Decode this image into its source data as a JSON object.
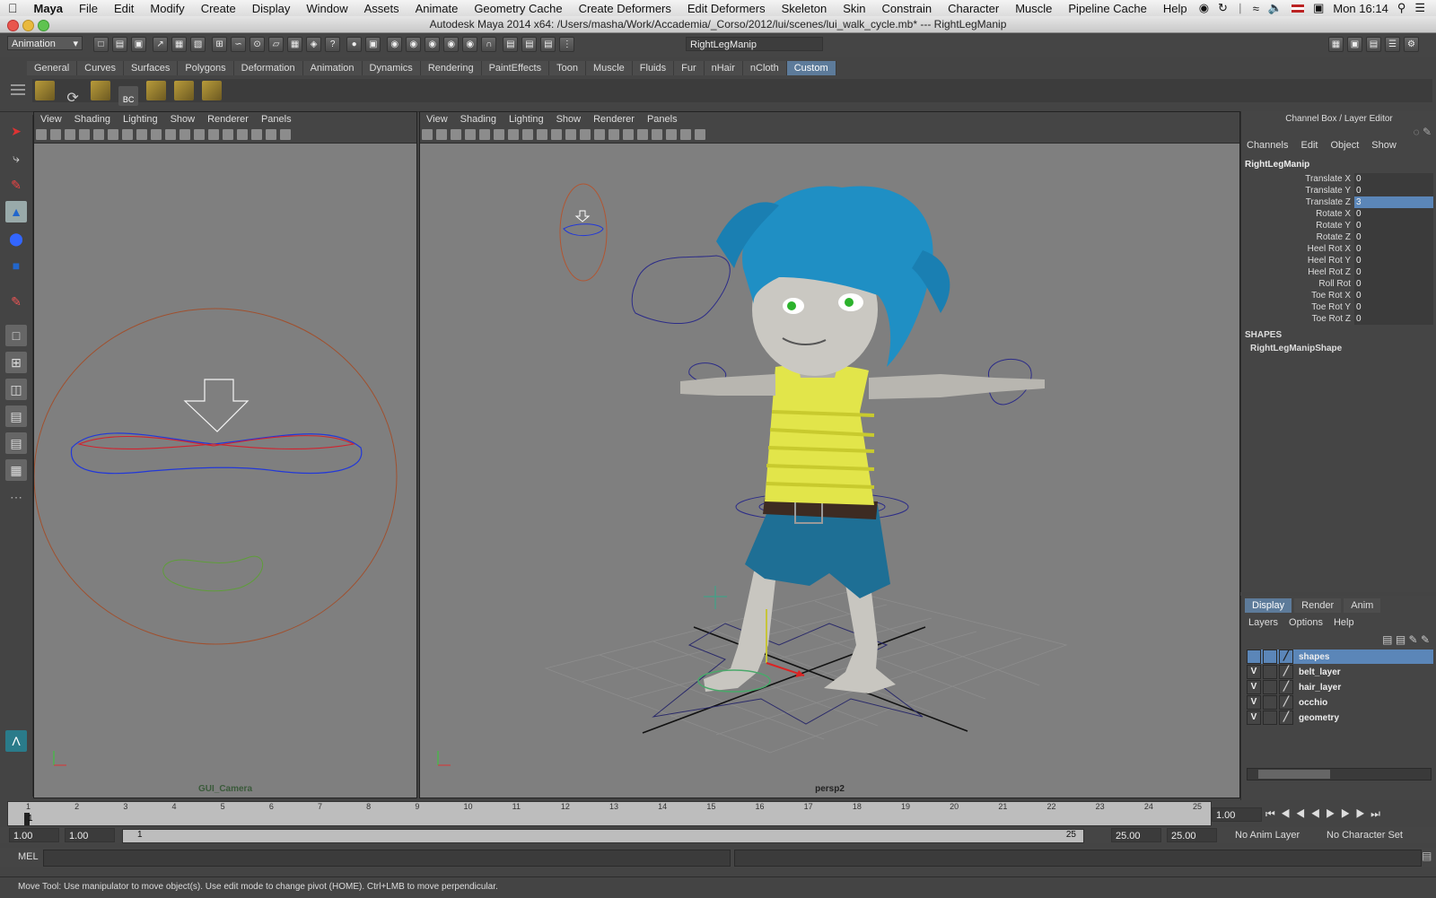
{
  "os_menubar": {
    "apple": "",
    "app": "Maya",
    "items": [
      "File",
      "Edit",
      "Modify",
      "Create",
      "Display",
      "Window",
      "Assets",
      "Animate",
      "Geometry Cache",
      "Create Deformers",
      "Edit Deformers",
      "Skeleton",
      "Skin",
      "Constrain",
      "Character",
      "Muscle",
      "Pipeline Cache",
      "Help"
    ],
    "clock": "Mon 16:14"
  },
  "window": {
    "title": "Autodesk Maya 2014 x64: /Users/masha/Work/Accademia/_Corso/2012/lui/scenes/lui_walk_cycle.mb*  ---  RightLegManip"
  },
  "statusline": {
    "menuset": "Animation",
    "object_field": "RightLegManip"
  },
  "shelf": {
    "tabs": [
      "General",
      "Curves",
      "Surfaces",
      "Polygons",
      "Deformation",
      "Animation",
      "Dynamics",
      "Rendering",
      "PaintEffects",
      "Toon",
      "Muscle",
      "Fluids",
      "Fur",
      "nHair",
      "nCloth",
      "Custom"
    ],
    "active_tab": "Custom",
    "bc_label": "BC"
  },
  "viewport_left": {
    "menu": [
      "View",
      "Shading",
      "Lighting",
      "Show",
      "Renderer",
      "Panels"
    ],
    "camera": "GUI_Camera"
  },
  "viewport_right": {
    "menu": [
      "View",
      "Shading",
      "Lighting",
      "Show",
      "Renderer",
      "Panels"
    ],
    "camera": "persp2"
  },
  "channel_box": {
    "title": "Channel Box / Layer Editor",
    "menu": [
      "Channels",
      "Edit",
      "Object",
      "Show"
    ],
    "object": "RightLegManip",
    "attributes": [
      {
        "name": "Translate X",
        "value": "0"
      },
      {
        "name": "Translate Y",
        "value": "0"
      },
      {
        "name": "Translate Z",
        "value": "3"
      },
      {
        "name": "Rotate X",
        "value": "0"
      },
      {
        "name": "Rotate Y",
        "value": "0"
      },
      {
        "name": "Rotate Z",
        "value": "0"
      },
      {
        "name": "Heel Rot X",
        "value": "0"
      },
      {
        "name": "Heel Rot Y",
        "value": "0"
      },
      {
        "name": "Heel Rot Z",
        "value": "0"
      },
      {
        "name": "Roll Rot",
        "value": "0"
      },
      {
        "name": "Toe Rot X",
        "value": "0"
      },
      {
        "name": "Toe Rot Y",
        "value": "0"
      },
      {
        "name": "Toe Rot Z",
        "value": "0"
      }
    ],
    "selected_attribute": "Translate Z",
    "shapes_header": "SHAPES",
    "shape_name": "RightLegManipShape"
  },
  "layer_editor": {
    "tabs": [
      "Display",
      "Render",
      "Anim"
    ],
    "active_tab": "Display",
    "menu": [
      "Layers",
      "Options",
      "Help"
    ],
    "layers": [
      {
        "vis": "",
        "name": "shapes",
        "selected": true
      },
      {
        "vis": "V",
        "name": "belt_layer",
        "selected": false
      },
      {
        "vis": "V",
        "name": "hair_layer",
        "selected": false
      },
      {
        "vis": "V",
        "name": "occhio",
        "selected": false
      },
      {
        "vis": "V",
        "name": "geometry",
        "selected": false
      }
    ]
  },
  "timeslider": {
    "ticks": [
      "1",
      "2",
      "3",
      "4",
      "5",
      "6",
      "7",
      "8",
      "9",
      "10",
      "11",
      "12",
      "13",
      "14",
      "15",
      "16",
      "17",
      "18",
      "19",
      "20",
      "21",
      "22",
      "23",
      "24",
      "25"
    ],
    "current_frame": "1",
    "current_time_field": "1.00"
  },
  "range_slider": {
    "start": "1.00",
    "playback_start": "1.00",
    "range_start_label": "1",
    "range_end_label": "25",
    "playback_end": "25.00",
    "end": "25.00",
    "anim_layer": "No Anim Layer",
    "character_set": "No Character Set"
  },
  "command_line": {
    "label": "MEL"
  },
  "help_line": {
    "text": "Move Tool: Use manipulator to move object(s). Use edit mode to change pivot (HOME). Ctrl+LMB to move perpendicular."
  },
  "colors": {
    "ui_bg": "#444444",
    "viewport_bg": "#7f7f7f",
    "selection": "#5b86b8",
    "hair": "#1f8fc4",
    "shirt": "#e5e74a",
    "shorts": "#1e6f95"
  }
}
